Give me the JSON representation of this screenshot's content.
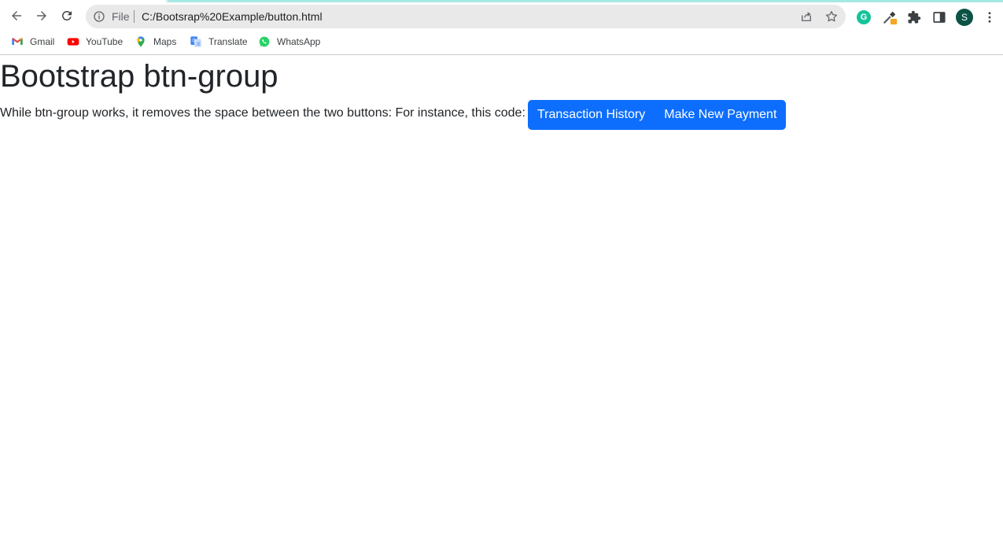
{
  "browser": {
    "omnibox": {
      "scheme_label": "File",
      "url": "C:/Bootsrap%20Example/button.html"
    },
    "profile_initial": "S",
    "bookmarks": [
      {
        "label": "Gmail",
        "icon": "gmail-icon"
      },
      {
        "label": "YouTube",
        "icon": "youtube-icon"
      },
      {
        "label": "Maps",
        "icon": "maps-icon"
      },
      {
        "label": "Translate",
        "icon": "translate-icon"
      },
      {
        "label": "WhatsApp",
        "icon": "whatsapp-icon"
      }
    ],
    "colors": {
      "omnibox_bg": "#e9e9e9",
      "avatar_bg": "#0b5345",
      "accent_stripe": "#a8e8e4"
    }
  },
  "page": {
    "title": "Bootstrap btn-group",
    "paragraph": "While btn-group works, it removes the space between the two buttons: For instance, this code:",
    "buttons": [
      {
        "label": "Transaction History"
      },
      {
        "label": "Make New Payment"
      }
    ],
    "colors": {
      "button_bg": "#0d6efd",
      "button_text": "#ffffff",
      "text": "#212529"
    }
  }
}
